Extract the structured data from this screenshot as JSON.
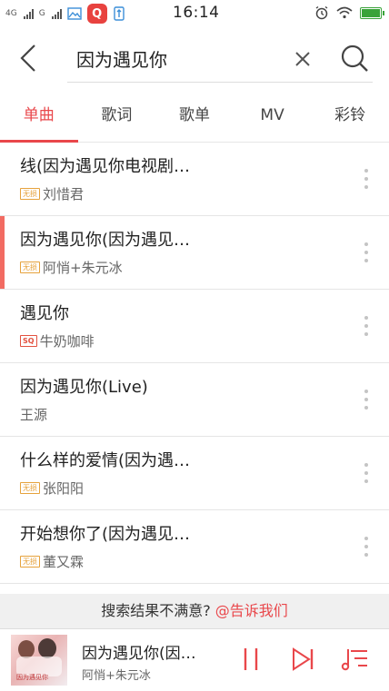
{
  "status": {
    "net_type_1": "4G",
    "net_type_2": "G",
    "time": "16:14",
    "app_icon_letter": "Q"
  },
  "search": {
    "query": "因为遇见你"
  },
  "tabs": [
    {
      "label": "单曲",
      "active": true
    },
    {
      "label": "歌词",
      "active": false
    },
    {
      "label": "歌单",
      "active": false
    },
    {
      "label": "MV",
      "active": false
    },
    {
      "label": "彩铃",
      "active": false
    }
  ],
  "songs": [
    {
      "title": "线(因为遇见你电视剧…",
      "badge": "无损",
      "badge_type": "lossless",
      "artist": "刘惜君",
      "playing": false
    },
    {
      "title": "因为遇见你(因为遇见…",
      "badge": "无损",
      "badge_type": "lossless",
      "artist": "阿悄+朱元冰",
      "playing": true
    },
    {
      "title": "遇见你",
      "badge": "SQ",
      "badge_type": "sq",
      "artist": "牛奶咖啡",
      "playing": false
    },
    {
      "title": "因为遇见你(Live)",
      "badge": "",
      "badge_type": "none",
      "artist": "王源",
      "playing": false
    },
    {
      "title": "什么样的爱情(因为遇…",
      "badge": "无损",
      "badge_type": "lossless",
      "artist": "张阳阳",
      "playing": false
    },
    {
      "title": "开始想你了(因为遇见…",
      "badge": "无损",
      "badge_type": "lossless",
      "artist": "董又霖",
      "playing": false
    }
  ],
  "feedback": {
    "prompt": "搜索结果不满意?",
    "link": "@告诉我们"
  },
  "player": {
    "title": "因为遇见你(因…",
    "artist": "阿悄+朱元冰",
    "cover_text": "因为遇见你"
  },
  "colors": {
    "accent": "#e9474b",
    "lossless_badge": "#e6a23c",
    "sq_badge": "#e2513f",
    "battery": "#3aa33a"
  },
  "icons": [
    "back-arrow-icon",
    "clear-x-icon",
    "search-icon",
    "more-dots-icon",
    "pause-icon",
    "next-icon",
    "playlist-icon",
    "wifi-icon",
    "alarm-icon",
    "battery-icon",
    "signal-icon",
    "gallery-icon",
    "usb-icon"
  ]
}
